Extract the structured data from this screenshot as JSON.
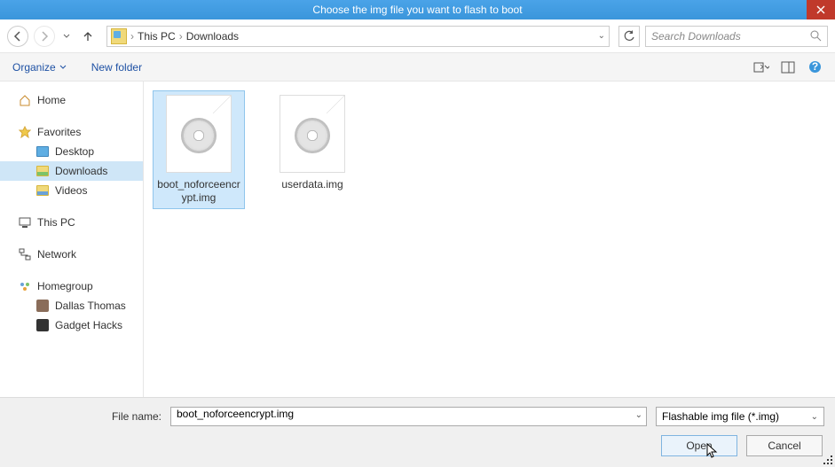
{
  "title": "Choose the img file you want to flash to boot",
  "breadcrumb": {
    "root": "This PC",
    "folder": "Downloads"
  },
  "search": {
    "placeholder": "Search Downloads"
  },
  "toolbar": {
    "organize": "Organize",
    "newfolder": "New folder"
  },
  "sidebar": {
    "home": "Home",
    "favorites": "Favorites",
    "desktop": "Desktop",
    "downloads": "Downloads",
    "videos": "Videos",
    "thispc": "This PC",
    "network": "Network",
    "homegroup": "Homegroup",
    "user1": "Dallas Thomas",
    "user2": "Gadget Hacks"
  },
  "files": [
    {
      "name": "boot_noforceencrypt.img",
      "selected": true
    },
    {
      "name": "userdata.img",
      "selected": false
    }
  ],
  "footer": {
    "filename_label": "File name:",
    "filename_value": "boot_noforceencrypt.img",
    "filter": "Flashable img file (*.img)",
    "open": "Open",
    "cancel": "Cancel"
  }
}
